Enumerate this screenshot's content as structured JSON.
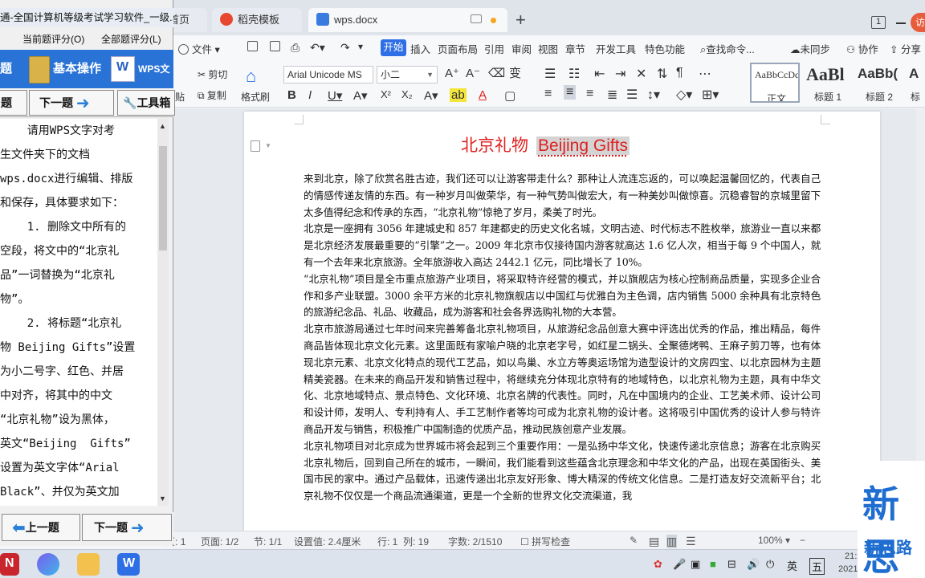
{
  "wps": {
    "tabs": [
      {
        "label": "首页"
      },
      {
        "label": "稻壳模板"
      },
      {
        "label": "wps.docx"
      }
    ],
    "new_tab": "+",
    "window_count": "1",
    "visit_label": "访",
    "menu": {
      "file": "文件",
      "items": [
        "开始",
        "插入",
        "页面布局",
        "引用",
        "审阅",
        "视图",
        "章节",
        "开发工具",
        "特色功能"
      ],
      "search": "查找命令...",
      "sync": "未同步",
      "collab": "协作",
      "share": "分享"
    },
    "ribbon": {
      "cut": "剪切",
      "copy": "复制",
      "format_painter": "格式刷",
      "paste_fragment": "贴",
      "font_name": "Arial Unicode MS",
      "font_size": "小二",
      "styles": [
        {
          "preview": "AaBbCcDd",
          "name": "正文"
        },
        {
          "preview": "AaBl",
          "name": "标题 1"
        },
        {
          "preview": "AaBb(",
          "name": "标题 2"
        },
        {
          "preview": "A",
          "name": "标"
        }
      ]
    },
    "document": {
      "title_cn": "北京礼物",
      "title_en": "Beijing Gifts",
      "paragraphs": [
        "来到北京，除了欣赏名胜古迹，我们还可以让游客带走什么？那种让人流连忘返的，可以唤起温馨回忆的，代表自己的情感传递友情的东西。有一种岁月叫做荣华，有一种气势叫做宏大，有一种美妙叫做惊喜。沉稳睿智的京城里留下太多值得纪念和传承的东西，“北京礼物”惊艳了岁月，柔美了时光。",
        "北京是一座拥有 3056 年建城史和 857 年建都史的历史文化名城，文明古迹、时代标志不胜枚举，旅游业一直以来都是北京经济发展最重要的“引擎”之一。2009 年北京市仅接待国内游客就高达 1.6 亿人次，相当于每 9 个中国人，就有一个去年来北京旅游。全年旅游收入高达 2442.1 亿元，同比增长了 10%。",
        "“北京礼物”项目是全市重点旅游产业项目，将采取特许经营的模式，并以旗舰店为核心控制商品质量，实现多企业合作和多产业联盟。3000 余平方米的北京礼物旗舰店以中国红与优雅白为主色调，店内销售 5000 余种具有北京特色的旅游纪念品、礼品、收藏品，成为游客和社会各界选购礼物的大本营。",
        "北京市旅游局通过七年时间来完善筹备北京礼物项目，从旅游纪念品创意大赛中评选出优秀的作品，推出精品，每件商品皆体现北京文化元素。这里面既有家喻户晓的北京老字号，如红星二锅头、全聚德烤鸭、王麻子剪刀等，也有体现北京元素、北京文化特点的现代工艺品，如以鸟巢、水立方等奥运场馆为造型设计的文房四宝、以北京园林为主题精美瓷器。在未来的商品开发和销售过程中，将继续充分体现北京特有的地域特色，以北京礼物为主题，具有中华文化、北京地域特点、景点特色、文化环境、北京名牌的代表性。同时，凡在中国境内的企业、工艺美术师、设计公司和设计师，发明人、专利持有人、手工艺制作者等均可成为北京礼物的设计者。这将吸引中国优秀的设计人参与特许商品开发与销售，积极推广中国制造的优质产品，推动民族创意产业发展。",
        "北京礼物项目对北京成为世界城市将会起到三个重要作用：一是弘扬中华文化，快速传递北京信息；游客在北京购买北京礼物后，回到自己所在的城市，一瞬间，我们能看到这些蕴含北京理念和中华文化的产品，出现在英国街头、美国市民的家中。通过产品载体，迅速传递出北京友好形象、博大精深的传统文化信息。二是打造友好交流新平台；北京礼物不仅仅是一个商品流通渠道，更是一个全新的世界文化交流渠道，我"
      ]
    },
    "status": {
      "page_label": "页",
      "page_num": "1",
      "pages": "页面: 1/2",
      "section": "节: 1/1",
      "setting": "设置值: 2.4厘米",
      "row": "行: 1",
      "col": "列: 19",
      "words": "字数: 2/1510",
      "spell": "拼写检查",
      "zoom": "100%"
    }
  },
  "panel": {
    "title": "通-全国计算机等级考试学习软件_一级...",
    "score_current": "当前题评分(O)",
    "score_all": "全部题评分(L)",
    "top_buttons": [
      "题",
      "基本操作",
      "WPS文字"
    ],
    "nav": {
      "prev_fragment": "题",
      "next": "下一题",
      "tools": "工具箱"
    },
    "lines": [
      "    请用WPS文字对考",
      "生文件夹下的文档",
      "wps.docx进行编辑、排版",
      "和保存，具体要求如下：",
      "    1. 删除文中所有的",
      "空段，将文中的“北京礼",
      "品”一词替换为“北京礼",
      "物”。",
      "    2. 将标题“北京礼",
      "物 Beijing Gifts”设置",
      "为小二号字、红色、并居",
      "中对齐，将其中的中文",
      "“北京礼物”设为黑体，",
      "英文“Beijing  Gifts”",
      "设置为英文字体“Arial",
      "Black”、并仅为英文加"
    ],
    "bottom": {
      "prev": "上一题",
      "next": "下一题"
    }
  },
  "taskbar": {
    "ime_cn": "英",
    "ime_mode": "五",
    "time": "21:20",
    "date": "2021-07-20"
  },
  "watermark": {
    "big": "新思",
    "small": "新思路"
  }
}
